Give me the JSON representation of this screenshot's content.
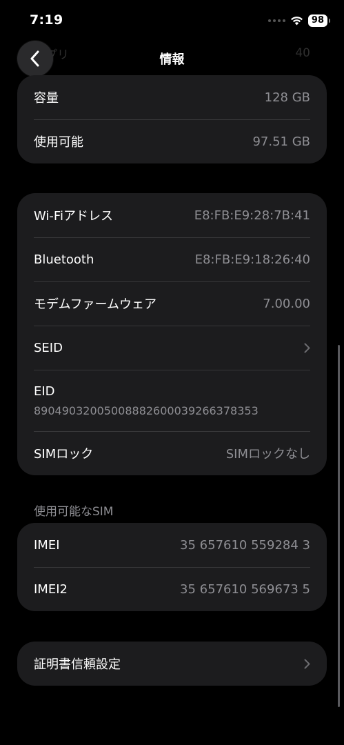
{
  "status_bar": {
    "time": "7:19",
    "battery": "98"
  },
  "nav": {
    "title": "情報",
    "ghost_label": "アプリ",
    "ghost_value": "40"
  },
  "storage": [
    {
      "label": "容量",
      "value": "128 GB"
    },
    {
      "label": "使用可能",
      "value": "97.51 GB"
    }
  ],
  "network": {
    "wifi": {
      "label": "Wi-Fiアドレス",
      "value": "E8:FB:E9:28:7B:41"
    },
    "bluetooth": {
      "label": "Bluetooth",
      "value": "E8:FB:E9:18:26:40"
    },
    "modem": {
      "label": "モデムファームウェア",
      "value": "7.00.00"
    },
    "seid": {
      "label": "SEID"
    },
    "eid": {
      "label": "EID",
      "value": "89049032005008882600039266378353"
    },
    "sim_lock": {
      "label": "SIMロック",
      "value": "SIMロックなし"
    }
  },
  "available_sim": {
    "header": "使用可能なSIM",
    "rows": [
      {
        "label": "IMEI",
        "value": "35 657610 559284 3"
      },
      {
        "label": "IMEI2",
        "value": "35 657610 569673 5"
      }
    ]
  },
  "certificate": {
    "label": "証明書信頼設定"
  },
  "icons": {
    "back": "chevron-left-icon",
    "disclosure": "chevron-right-icon",
    "wifi": "wifi-icon",
    "signal": "cellular-signal-icon",
    "battery": "battery-icon"
  }
}
